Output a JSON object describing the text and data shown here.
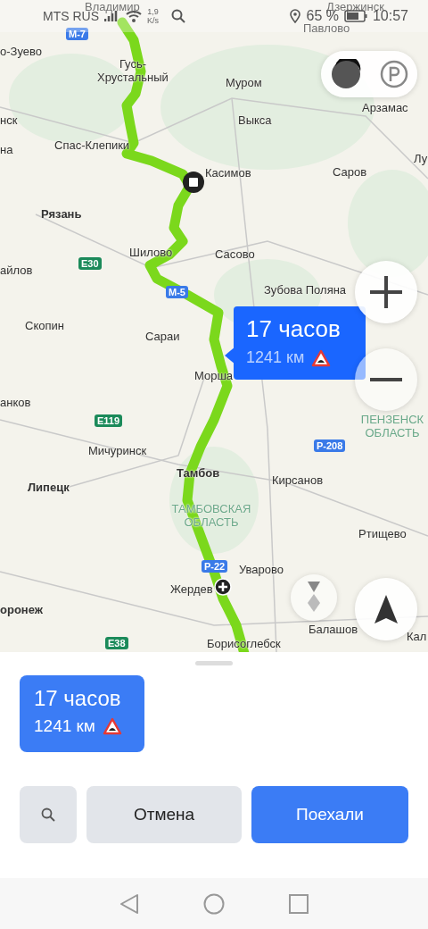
{
  "status_bar": {
    "carrier": "MTS RUS",
    "speed": "1,9",
    "speed_unit": "K/s",
    "battery": "65 %",
    "time": "10:57"
  },
  "map": {
    "places": [
      {
        "name": "Владимир",
        "kind": "city"
      },
      {
        "name": "Дзержинск",
        "kind": "city"
      },
      {
        "name": "Павлово",
        "kind": "city"
      },
      {
        "name": "о-Зуево",
        "kind": "city"
      },
      {
        "name": "Гусь-Хрустальный",
        "kind": "city"
      },
      {
        "name": "Муром",
        "kind": "city"
      },
      {
        "name": "Арзамас",
        "kind": "city"
      },
      {
        "name": "нск",
        "kind": "city"
      },
      {
        "name": "Выкса",
        "kind": "city"
      },
      {
        "name": "Спас-Клепики",
        "kind": "city"
      },
      {
        "name": "на",
        "kind": "city"
      },
      {
        "name": "Лу",
        "kind": "city"
      },
      {
        "name": "Касимов",
        "kind": "city"
      },
      {
        "name": "Саров",
        "kind": "city"
      },
      {
        "name": "Рязань",
        "kind": "major"
      },
      {
        "name": "Шилово",
        "kind": "city"
      },
      {
        "name": "Сасово",
        "kind": "city"
      },
      {
        "name": "айлов",
        "kind": "city"
      },
      {
        "name": "Зубова Поляна",
        "kind": "city"
      },
      {
        "name": "Скопин",
        "kind": "city"
      },
      {
        "name": "Сараи",
        "kind": "city"
      },
      {
        "name": "Морша",
        "kind": "city"
      },
      {
        "name": "анков",
        "kind": "city"
      },
      {
        "name": "ПЕНЗЕНСК ОБЛАСТЬ",
        "kind": "region"
      },
      {
        "name": "Мичуринск",
        "kind": "city"
      },
      {
        "name": "Тамбов",
        "kind": "major"
      },
      {
        "name": "Кирсанов",
        "kind": "city"
      },
      {
        "name": "Липецк",
        "kind": "major"
      },
      {
        "name": "ТАМБОВСКАЯ ОБЛАСТЬ",
        "kind": "region"
      },
      {
        "name": "Ртищево",
        "kind": "city"
      },
      {
        "name": "Уварово",
        "kind": "city"
      },
      {
        "name": "Жердев",
        "kind": "city"
      },
      {
        "name": "оронеж",
        "kind": "major"
      },
      {
        "name": "Балашов",
        "kind": "city"
      },
      {
        "name": "Кал",
        "kind": "city"
      },
      {
        "name": "Борисоглебск",
        "kind": "city"
      }
    ],
    "road_signs": [
      {
        "label": "М-7",
        "kind": "federal"
      },
      {
        "label": "E30",
        "kind": "european"
      },
      {
        "label": "М-5",
        "kind": "federal"
      },
      {
        "label": "E119",
        "kind": "european"
      },
      {
        "label": "Р-208",
        "kind": "federal"
      },
      {
        "label": "Р-22",
        "kind": "federal"
      },
      {
        "label": "E38",
        "kind": "european"
      }
    ],
    "route_bubble": {
      "duration": "17 часов",
      "distance": "1241 км"
    }
  },
  "route_card": {
    "duration": "17 часов",
    "distance": "1241 км"
  },
  "buttons": [
    {
      "label": "Отмена",
      "kind": "secondary"
    },
    {
      "label": "Поехали",
      "kind": "primary"
    }
  ]
}
